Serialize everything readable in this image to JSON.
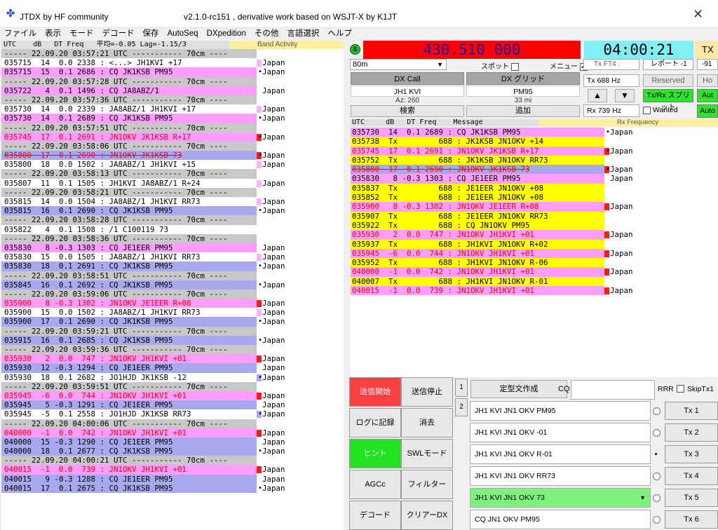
{
  "title": {
    "app": "JTDX  by HF community",
    "version": "v2.1.0-rc151 , derivative work based on WSJT-X by K1JT",
    "close": "✕"
  },
  "menu": [
    "ファイル",
    "表示",
    "モード",
    "デコード",
    "保存",
    "AutoSeq",
    "DXpedition",
    "その他",
    "言語選択",
    "ヘルプ"
  ],
  "left": {
    "header": "UTC    dB   DT Freq   平均=-0.05 Lag=-1.15/3",
    "header_right": "Band Activity",
    "rows": [
      {
        "t": "----- 22.09.20 03:57:21 UTC ----------- 70cm ----",
        "bg": "#c8c8c8",
        "mk": "",
        "dot": "",
        "c": ""
      },
      {
        "t": "035715  14  0.0 2338 : <...> JH1KVI +17",
        "bg": "#ffffff",
        "mk": "#ffb3ff",
        "dot": "",
        "c": "Japan"
      },
      {
        "t": "035715  15  0.1 2686 : CQ JK1KSB PM95",
        "bg": "#ff9eff",
        "mk": "",
        "dot": "•",
        "c": "Japan"
      },
      {
        "t": "----- 22.09.20 03:57:28 UTC ----------- 70cm ----",
        "bg": "#c8c8c8",
        "mk": "",
        "dot": "",
        "c": ""
      },
      {
        "t": "035722   4  0.1 1496 : CQ JA8ABZ/1",
        "bg": "#ff9eff",
        "mk": "",
        "dot": "",
        "c": "Japan"
      },
      {
        "t": "----- 22.09.20 03:57:36 UTC ----------- 70cm ----",
        "bg": "#c8c8c8",
        "mk": "",
        "dot": "",
        "c": ""
      },
      {
        "t": "035730  14  0.0 2339 : JA8ABZ/1 JH1KVI +17",
        "bg": "#ffffff",
        "mk": "#ffb3ff",
        "dot": "",
        "c": "Japan"
      },
      {
        "t": "035730  14  0.1 2689 : CQ JK1KSB PM95",
        "bg": "#ff9eff",
        "mk": "",
        "dot": "•",
        "c": "Japan"
      },
      {
        "t": "----- 22.09.20 03:57:51 UTC ----------- 70cm ----",
        "bg": "#c8c8c8",
        "mk": "",
        "dot": "",
        "c": ""
      },
      {
        "t": "035745  17  0.1 2691 : JN1OKV JK1KSB R+17",
        "bg": "#ff9eff",
        "mk": "#ff1a1a",
        "dot": "•",
        "c": "Japan",
        "red": true
      },
      {
        "t": "----- 22.09.20 03:58:06 UTC ----------- 70cm ----",
        "bg": "#c8c8c8",
        "mk": "",
        "dot": "",
        "c": ""
      },
      {
        "t": "035800  17  0.1 2690 : JN1OKV JK1KSB 73",
        "bg": "#a8a8ee",
        "mk": "#ff1a1a",
        "dot": "•",
        "c": "Japan",
        "red": true,
        "strike": true
      },
      {
        "t": "035800  18  0.0 1502 : JA8ABZ/1 JH1KVI +15",
        "bg": "#ffffff",
        "mk": "#ffb3ff",
        "dot": "",
        "c": "Japan"
      },
      {
        "t": "----- 22.09.20 03:58:13 UTC ----------- 70cm ----",
        "bg": "#c8c8c8",
        "mk": "",
        "dot": "",
        "c": ""
      },
      {
        "t": "035807  11  0.1 1505 : JH1KVI JA8ABZ/1 R+24",
        "bg": "#ffffff",
        "mk": "#ffb3ff",
        "dot": "",
        "c": "Japan"
      },
      {
        "t": "----- 22.09.20 03:58:21 UTC ----------- 70cm ----",
        "bg": "#c8c8c8",
        "mk": "",
        "dot": "",
        "c": ""
      },
      {
        "t": "035815  14  0.0 1504 : JA8ABZ/1 JH1KVI RR73",
        "bg": "#ffffff",
        "mk": "#ffb3ff",
        "dot": "",
        "c": "Japan"
      },
      {
        "t": "035815  16  0.1 2690 : CQ JK1KSB PM95",
        "bg": "#a8a8ee",
        "mk": "",
        "dot": "•",
        "c": "Japan"
      },
      {
        "t": "----- 22.09.20 03:58:28 UTC ----------- 70cm ----",
        "bg": "#c8c8c8",
        "mk": "",
        "dot": "",
        "c": ""
      },
      {
        "t": "035822   4  0.1 1508 : /1 C100119 73",
        "bg": "#ffffff",
        "mk": "",
        "dot": "",
        "c": ""
      },
      {
        "t": "----- 22.09.20 03:58:36 UTC ----------- 70cm ----",
        "bg": "#c8c8c8",
        "mk": "",
        "dot": "",
        "c": ""
      },
      {
        "t": "035830   8 -0.3 1303 : CQ JE1EER PM95",
        "bg": "#ff9eff",
        "mk": "",
        "dot": "",
        "c": "Japan"
      },
      {
        "t": "035830  15  0.0 1505 : JA8ABZ/1 JH1KVI RR73",
        "bg": "#ffffff",
        "mk": "#ffb3ff",
        "dot": "",
        "c": "Japan"
      },
      {
        "t": "035830  18  0.1 2691 : CQ JK1KSB PM95",
        "bg": "#a8a8ee",
        "mk": "",
        "dot": "•",
        "c": "Japan"
      },
      {
        "t": "----- 22.09.20 03:58:51 UTC ----------- 70cm ----",
        "bg": "#c8c8c8",
        "mk": "",
        "dot": "",
        "c": ""
      },
      {
        "t": "035845  16  0.1 2692 : CQ JK1KSB PM95",
        "bg": "#a8a8ee",
        "mk": "",
        "dot": "•",
        "c": "Japan"
      },
      {
        "t": "----- 22.09.20 03:59:06 UTC ----------- 70cm ----",
        "bg": "#c8c8c8",
        "mk": "",
        "dot": "",
        "c": ""
      },
      {
        "t": "035900   8 -0.3 1302 : JN1OKV JE1EER R+08",
        "bg": "#ff9eff",
        "mk": "#ff1a1a",
        "dot": "",
        "c": "Japan",
        "red": true
      },
      {
        "t": "035900  15  0.0 1502 : JA8ABZ/1 JH1KVI RR73",
        "bg": "#ffffff",
        "mk": "#ffb3ff",
        "dot": "",
        "c": "Japan"
      },
      {
        "t": "035900  17  0.1 2690 : CQ JK1KSB PM95",
        "bg": "#a8a8ee",
        "mk": "",
        "dot": "•",
        "c": "Japan"
      },
      {
        "t": "----- 22.09.20 03:59:21 UTC ----------- 70cm ----",
        "bg": "#c8c8c8",
        "mk": "",
        "dot": "",
        "c": ""
      },
      {
        "t": "035915  16  0.1 2685 : CQ JK1KSB PM95",
        "bg": "#a8a8ee",
        "mk": "",
        "dot": "•",
        "c": "Japan"
      },
      {
        "t": "----- 22.09.20 03:59:36 UTC ----------- 70cm ----",
        "bg": "#c8c8c8",
        "mk": "",
        "dot": "",
        "c": ""
      },
      {
        "t": "035930   2  0.0  747 : JN1OKV JH1KVI +01",
        "bg": "#ff9eff",
        "mk": "#ff1a1a",
        "dot": "",
        "c": "Japan",
        "red": true
      },
      {
        "t": "035930  12 -0.3 1294 : CQ JE1EER PM95",
        "bg": "#a8a8ee",
        "mk": "",
        "dot": "",
        "c": "Japan"
      },
      {
        "t": "035930  18  0.1 2682 : JO1HJD JK1KSB -12",
        "bg": "#ffffff",
        "mk": "#a8a8ee",
        "dot": "•",
        "c": "Japan"
      },
      {
        "t": "----- 22.09.20 03:59:51 UTC ----------- 70cm ----",
        "bg": "#c8c8c8",
        "mk": "",
        "dot": "",
        "c": ""
      },
      {
        "t": "035945  -6  0.0  744 : JN1OKV JH1KVI +01",
        "bg": "#ff9eff",
        "mk": "#ff1a1a",
        "dot": "",
        "c": "Japan",
        "red": true
      },
      {
        "t": "035945   5 -0.3 1291 : CQ JE1EER PM95",
        "bg": "#a8a8ee",
        "mk": "",
        "dot": "",
        "c": "Japan"
      },
      {
        "t": "035945  -5  0.1 2558 : JO1HJD JK1KSB RR73",
        "bg": "#ffffff",
        "mk": "#a8a8ee",
        "dot": "•",
        "c": "Japan"
      },
      {
        "t": "----- 22.09.20 04:00:06 UTC ----------- 70cm ----",
        "bg": "#c8c8c8",
        "mk": "",
        "dot": "",
        "c": ""
      },
      {
        "t": "040000  -1  0.0  742 : JN1OKV JH1KVI +01",
        "bg": "#ff9eff",
        "mk": "#ff1a1a",
        "dot": "",
        "c": "Japan",
        "red": true
      },
      {
        "t": "040000  15 -0.3 1290 : CQ JE1EER PM95",
        "bg": "#a8a8ee",
        "mk": "",
        "dot": "",
        "c": "Japan"
      },
      {
        "t": "040000  18  0.1 2677 : CQ JK1KSB PM95",
        "bg": "#a8a8ee",
        "mk": "",
        "dot": "•",
        "c": "Japan"
      },
      {
        "t": "----- 22.09.20 04:00:21 UTC ----------- 70cm ----",
        "bg": "#c8c8c8",
        "mk": "",
        "dot": "",
        "c": ""
      },
      {
        "t": "040015  -1  0.0  739 : JN1OKV JH1KVI +01",
        "bg": "#ff9eff",
        "mk": "#ff1a1a",
        "dot": "",
        "c": "Japan",
        "red": true
      },
      {
        "t": "040015   9 -0.3 1288 : CQ JE1EER PM95",
        "bg": "#a8a8ee",
        "mk": "",
        "dot": "",
        "c": "Japan"
      },
      {
        "t": "040015  17  0.1 2675 : CQ JK1KSB PM95",
        "bg": "#a8a8ee",
        "mk": "",
        "dot": "•",
        "c": "Japan"
      }
    ]
  },
  "top": {
    "s_badge": "S",
    "frequency": "430.510 000",
    "clock": "04:00:21",
    "tx_badge": "TX",
    "band": "80m",
    "spot_label": "スポット",
    "memo_label": "メニュー",
    "mode": "Tx FT4 :",
    "report": "レポート -1",
    "db": "-91",
    "dx_call_label": "DX Call",
    "dx_grid_label": "DX グリッド",
    "dx_call": "JH1 KVI",
    "dx_grid": "PM95",
    "az": "Az: 260",
    "dist": "33 mi",
    "lookup": "検索",
    "add": "追加",
    "tx_freq": "Tx  688  Hz",
    "rx_freq": "Rx  739  Hz",
    "reserved": "Reserved",
    "txrx_split": "Tx/Rx スプリット",
    "wanted": "Wanted",
    "ho": "Ho",
    "auto1": "Aut",
    "auto2": "Auto",
    "up": "▲",
    "down": "▼"
  },
  "rx": {
    "header": "UTC     dB   DT Freq    Message",
    "header_right": "Rx  Frequency",
    "rows": [
      {
        "t": "035730  14  0.1 2689 : CQ JK1KSB PM95",
        "bg": "#ff9eff",
        "mk": "",
        "dot": "•",
        "c": "Japan"
      },
      {
        "t": "035738  Tx         688 : JK1KSB JN1OKV +14",
        "bg": "#ffff00",
        "mk": "",
        "dot": "",
        "c": ""
      },
      {
        "t": "035745  17  0.1 2691 : JN1OKV JK1KSB R+17",
        "bg": "#ff9eff",
        "mk": "#ff1a1a",
        "dot": "•",
        "c": "Japan",
        "red": true
      },
      {
        "t": "035752  Tx         688 : JK1KSB JN1OKV RR73",
        "bg": "#ffff00",
        "mk": "",
        "dot": "",
        "c": ""
      },
      {
        "t": "035800  17  0.1 2690 : JN1OKV JK1KSB 73",
        "bg": "#a8a8ee",
        "mk": "#ff1a1a",
        "dot": "•",
        "c": "Japan",
        "red": true,
        "strike": true
      },
      {
        "t": "035830   8 -0.3 1303 : CQ JE1EER PM95",
        "bg": "#ff9eff",
        "mk": "",
        "dot": "",
        "c": "Japan"
      },
      {
        "t": "035837  Tx         688 : JE1EER JN1OKV +08",
        "bg": "#ffff00",
        "mk": "",
        "dot": "",
        "c": ""
      },
      {
        "t": "035852  Tx         688 : JE1EER JN1OKV +08",
        "bg": "#ffff00",
        "mk": "",
        "dot": "",
        "c": ""
      },
      {
        "t": "035900   8 -0.3 1302 : JN1OKV JE1EER R+08",
        "bg": "#ff9eff",
        "mk": "#ff1a1a",
        "dot": "",
        "c": "Japan",
        "red": true
      },
      {
        "t": "035907  Tx         688 : JE1EER JN1OKV RR73",
        "bg": "#ffff00",
        "mk": "",
        "dot": "",
        "c": ""
      },
      {
        "t": "035922  Tx         688 : CQ JN1OKV PM95",
        "bg": "#ffff00",
        "mk": "",
        "dot": "",
        "c": ""
      },
      {
        "t": "035930   2  0.0  747 : JN1OKV JH1KVI +01",
        "bg": "#ff9eff",
        "mk": "#ff1a1a",
        "dot": "",
        "c": "Japan",
        "red": true
      },
      {
        "t": "035937  Tx         688 : JH1KVI JN1OKV R+02",
        "bg": "#ffff00",
        "mk": "",
        "dot": "",
        "c": ""
      },
      {
        "t": "035945  -6  0.0  744 : JN1OKV JH1KVI +01",
        "bg": "#ff9eff",
        "mk": "#ff1a1a",
        "dot": "",
        "c": "Japan",
        "red": true
      },
      {
        "t": "035952  Tx         688 : JH1KVI JN1OKV R-06",
        "bg": "#ffff00",
        "mk": "",
        "dot": "",
        "c": ""
      },
      {
        "t": "040000  -1  0.0  742 : JN1OKV JH1KVI +01",
        "bg": "#ff9eff",
        "mk": "#ff1a1a",
        "dot": "",
        "c": "Japan",
        "red": true
      },
      {
        "t": "040007  Tx         688 : JH1KVI JN1OKV R-01",
        "bg": "#ffff00",
        "mk": "",
        "dot": "",
        "c": ""
      },
      {
        "t": "040015  -1  0.0  739 : JN1OKV JH1KVI +01",
        "bg": "#ff9eff",
        "mk": "#ff1a1a",
        "dot": "",
        "c": "Japan",
        "red": true
      }
    ]
  },
  "controls": {
    "enable_tx": "送信開始",
    "stop_tx": "送信停止",
    "log_qso": "ログに記録",
    "erase": "消去",
    "tune": "ヒント",
    "swl": "SWLモード",
    "agcc": "AGCc",
    "filter": "フィルター",
    "decode": "デコード",
    "clear_dx": "クリアーDX",
    "tab1": "1",
    "tab2": "2",
    "gen_msgs": "定型文作成",
    "cq_label": "CQ",
    "rrr": "RRR",
    "skiptx1": "SkipTx1",
    "messages": [
      {
        "text": "JH1 KVI JN1 OKV PM95",
        "tx": "Tx 1",
        "on": false,
        "hl": false
      },
      {
        "text": "JH1 KVI JN1 OKV -01",
        "tx": "Tx 2",
        "on": false,
        "hl": false
      },
      {
        "text": "JH1 KVI JN1 OKV R-01",
        "tx": "Tx 3",
        "on": true,
        "hl": false
      },
      {
        "text": "JH1 KVI JN1 OKV RR73",
        "tx": "Tx 4",
        "on": false,
        "hl": false
      },
      {
        "text": "JH1 KVI JN1 OKV 73",
        "tx": "Tx 5",
        "on": false,
        "hl": true
      },
      {
        "text": "CQ JN1 OKV PM95",
        "tx": "Tx 6",
        "on": false,
        "hl": false
      }
    ]
  },
  "colors": {
    "red": "#ff0000",
    "cyan": "#7ff0f5",
    "pink": "#ff9eff",
    "blue": "#a8a8ee",
    "yellow": "#ffff00",
    "green": "#2ee22e"
  }
}
